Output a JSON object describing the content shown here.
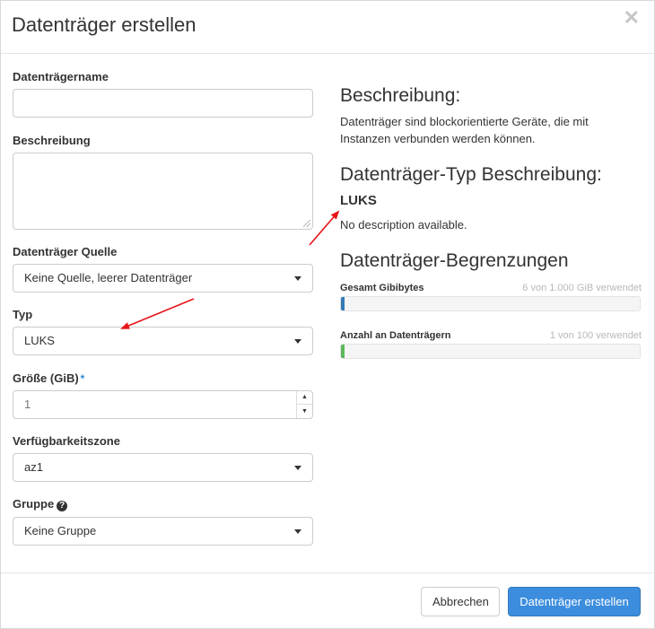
{
  "dialog": {
    "title": "Datenträger erstellen",
    "close_symbol": "✕"
  },
  "form": {
    "name": {
      "label": "Datenträgername",
      "value": ""
    },
    "description": {
      "label": "Beschreibung",
      "value": ""
    },
    "source": {
      "label": "Datenträger Quelle",
      "value": "Keine Quelle, leerer Datenträger"
    },
    "type": {
      "label": "Typ",
      "value": "LUKS"
    },
    "size": {
      "label": "Größe (GiB)",
      "required_mark": "*",
      "value": "1"
    },
    "availability_zone": {
      "label": "Verfügbarkeitszone",
      "value": "az1"
    },
    "group": {
      "label": "Gruppe",
      "help_icon": "question-circle-icon",
      "value": "Keine Gruppe"
    }
  },
  "info_panel": {
    "description_heading": "Beschreibung:",
    "description_text": "Datenträger sind blockorientierte Geräte, die mit Instanzen verbunden werden können.",
    "type_heading": "Datenträger-Typ Beschreibung:",
    "type_name": "LUKS",
    "type_description": "No description available.",
    "limits_heading": "Datenträger-Begrenzungen",
    "quotas": [
      {
        "label": "Gesamt Gibibytes",
        "usage_text": "6 von 1.000 GiB verwendet",
        "used": 6,
        "limit": 1000,
        "color": "#337ab7"
      },
      {
        "label": "Anzahl an Datenträgern",
        "usage_text": "1 von 100 verwendet",
        "used": 1,
        "limit": 100,
        "color": "#5cb85c"
      }
    ]
  },
  "footer": {
    "cancel_label": "Abbrechen",
    "submit_label": "Datenträger erstellen"
  },
  "colors": {
    "primary": "#3c8dde",
    "annotation_arrow": "#e8141a"
  }
}
